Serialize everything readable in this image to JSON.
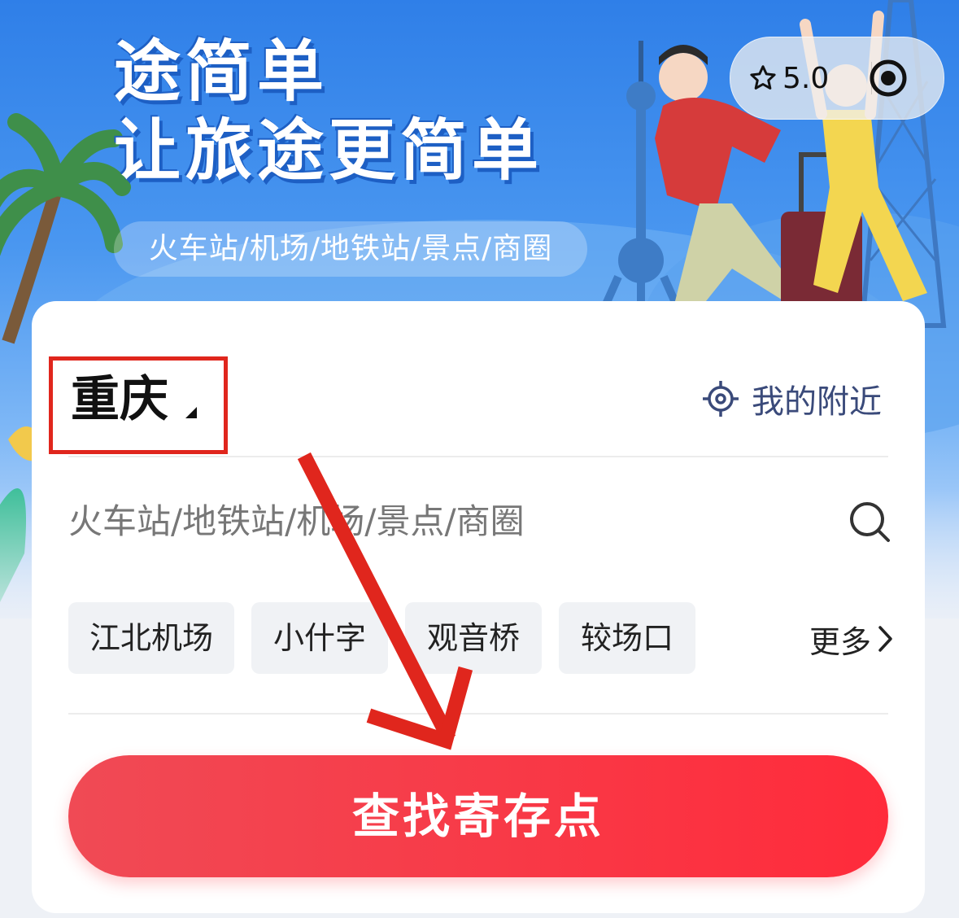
{
  "banner": {
    "slogan_line1": "途简单",
    "slogan_line2": "让旅途更简单",
    "tagline": "火车站/机场/地铁站/景点/商圈"
  },
  "capsule": {
    "rating": "5.0",
    "rating_icon": "star-outline-icon",
    "action_icon": "target-icon"
  },
  "location": {
    "city": "重庆",
    "nearby_label": "我的附近",
    "nearby_icon": "locate-icon"
  },
  "search": {
    "placeholder": "火车站/地铁站/机场/景点/商圈",
    "icon": "search-icon"
  },
  "quick_tags": [
    "江北机场",
    "小什字",
    "观音桥",
    "较场口"
  ],
  "more_label": "更多",
  "find_button": "查找寄存点",
  "colors": {
    "primary_red": "#ff2b3b",
    "banner_blue": "#2f7fe8",
    "annotation_red": "#e0261d"
  }
}
